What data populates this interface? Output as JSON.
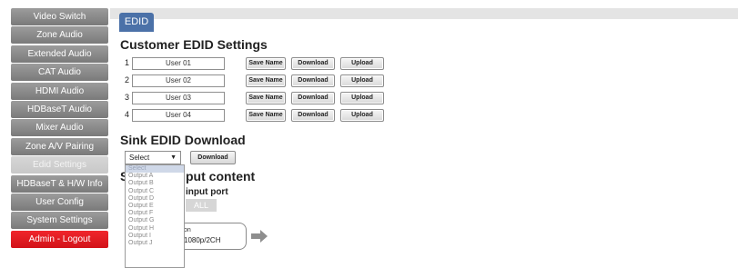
{
  "sidebar": {
    "items": [
      {
        "label": "Video Switch"
      },
      {
        "label": "Zone Audio"
      },
      {
        "label": "Extended Audio"
      },
      {
        "label": "CAT Audio"
      },
      {
        "label": "HDMI Audio"
      },
      {
        "label": "HDBaseT Audio"
      },
      {
        "label": "Mixer Audio"
      },
      {
        "label": "Zone A/V Pairing"
      },
      {
        "label": "Edid Settings"
      },
      {
        "label": "HDBaseT & H/W Info"
      },
      {
        "label": "User Config"
      },
      {
        "label": "System Settings"
      },
      {
        "label": "Admin - Logout"
      }
    ]
  },
  "tab": {
    "label": "EDID"
  },
  "customer": {
    "title": "Customer EDID Settings",
    "rows": [
      {
        "num": "1",
        "value": "User 01"
      },
      {
        "num": "2",
        "value": "User 02"
      },
      {
        "num": "3",
        "value": "User 03"
      },
      {
        "num": "4",
        "value": "User 04"
      }
    ],
    "save_label": "Save Name",
    "download_label": "Download",
    "upload_label": "Upload"
  },
  "sink": {
    "title": "Sink EDID Download",
    "select_value": "Select",
    "download_label": "Download",
    "options": [
      "Select",
      "Output A",
      "Output B",
      "Output C",
      "Output D",
      "Output E",
      "Output F",
      "Output G",
      "Output H",
      "Output I",
      "Output J"
    ]
  },
  "partial": {
    "heading_s": "S",
    "heading_rest": "put content",
    "input_port": "input port",
    "all_label": "ALL",
    "source_small": "on",
    "source_big": "1080p/2CH"
  },
  "colors": {
    "accent": "#4b71a8",
    "logout": "#e0141c",
    "nav": "#8a8a8a"
  }
}
